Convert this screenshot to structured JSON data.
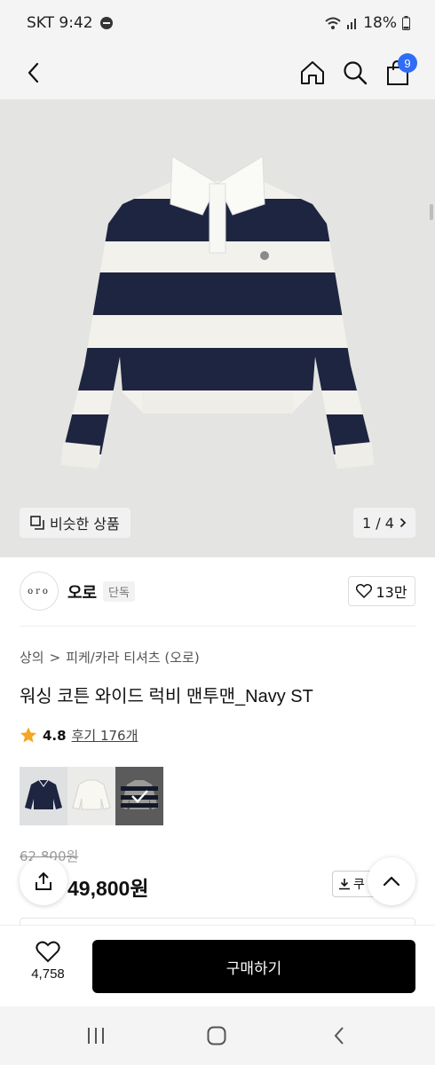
{
  "status_bar": {
    "carrier_time": "SKT 9:42",
    "battery": "18%"
  },
  "header": {
    "cart_count": "9"
  },
  "gallery": {
    "similar_label": "비슷한 상품",
    "page_indicator": "1 / 4"
  },
  "brand": {
    "logo_text": "oro",
    "name": "오로",
    "tag": "단독",
    "likes": "13만"
  },
  "breadcrumb": {
    "category": "상의",
    "separator": ">",
    "subcategory": "피케/카라 티셔츠 (오로)"
  },
  "product": {
    "title": "워싱 코튼 와이드 럭비 맨투맨_Navy ST",
    "rating": "4.8",
    "reviews": "후기 176개",
    "original_price": "62,800원",
    "sale_price": "49,800원",
    "coupon_label": "쿠"
  },
  "colors": {
    "star": "#f5a623",
    "cart_badge": "#2f6df6",
    "stripe_navy": "#1e2540"
  },
  "bottom_bar": {
    "wish_count": "4,758",
    "buy_label": "구매하기"
  }
}
